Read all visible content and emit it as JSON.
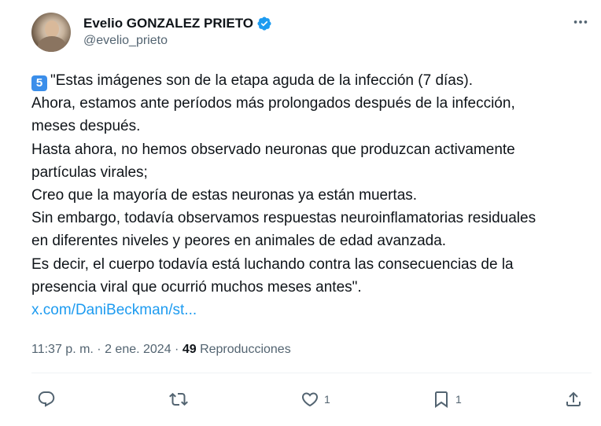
{
  "tweet": {
    "author_name": "Evelio GONZALEZ PRIETO",
    "author_handle": "@evelio_prieto",
    "keycap_emoji": "5",
    "lines": [
      "\"Estas imágenes son de la etapa aguda de la infección (7 días).",
      "Ahora, estamos ante períodos más prolongados después de la infección,",
      "meses después.",
      "Hasta ahora, no hemos observado neuronas que produzcan activamente",
      "partículas virales;",
      "Creo que la mayoría de estas neuronas ya están muertas.",
      "Sin embargo, todavía observamos respuestas neuroinflamatorias residuales",
      "en diferentes niveles y peores en animales de edad avanzada.",
      "Es decir, el cuerpo todavía está luchando contra las consecuencias de la",
      "presencia viral que ocurrió muchos meses antes\"."
    ],
    "link_text": "x.com/DaniBeckman/st...",
    "time": "11:37 p. m.",
    "separator": " · ",
    "date": "2 ene. 2024",
    "views_count": "49",
    "views_label": " Reproducciones"
  },
  "actions": {
    "like_count": "1",
    "bookmark_count": "1"
  },
  "colors": {
    "verified_badge": "#1d9bf0",
    "link": "#1d9bf0",
    "secondary_text": "#536471",
    "primary_text": "#0f1419"
  },
  "icons": [
    "verified-badge-icon",
    "more-icon",
    "reply-icon",
    "retweet-icon",
    "like-icon",
    "bookmark-icon",
    "share-icon"
  ]
}
